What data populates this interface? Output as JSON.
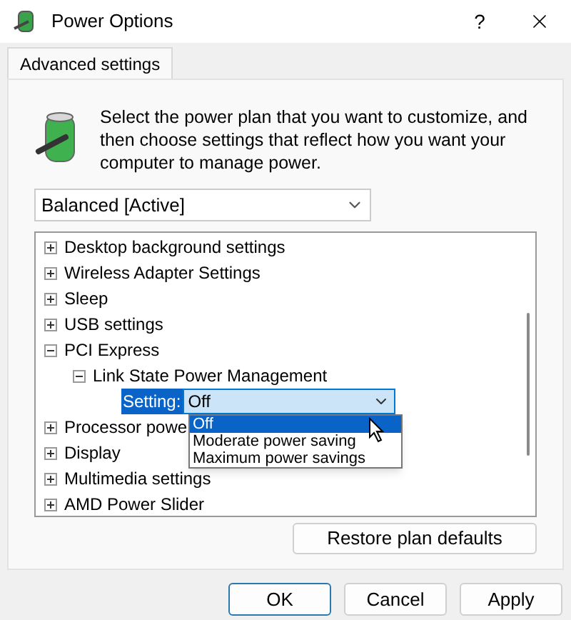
{
  "window": {
    "title": "Power Options",
    "help_button": "?"
  },
  "tabs": [
    {
      "label": "Advanced settings",
      "selected": true
    }
  ],
  "description": "Select the power plan that you want to customize, and then choose settings that reflect how you want your computer to manage power.",
  "plan_select": {
    "value": "Balanced [Active]"
  },
  "tree": [
    {
      "kind": "node",
      "label": "Desktop background settings",
      "expanded": false
    },
    {
      "kind": "node",
      "label": "Wireless Adapter Settings",
      "expanded": false
    },
    {
      "kind": "node",
      "label": "Sleep",
      "expanded": false
    },
    {
      "kind": "node",
      "label": "USB settings",
      "expanded": false
    },
    {
      "kind": "node",
      "label": "PCI Express",
      "expanded": true,
      "children": [
        {
          "kind": "node",
          "label": "Link State Power Management",
          "expanded": true,
          "children": [
            {
              "kind": "setting",
              "label": "Setting:",
              "value": "Off",
              "expanded": true,
              "options": [
                {
                  "label": "Off",
                  "selected": true
                },
                {
                  "label": "Moderate power saving",
                  "selected": false
                },
                {
                  "label": "Maximum power savings",
                  "selected": false
                }
              ]
            }
          ]
        }
      ]
    },
    {
      "kind": "node",
      "label": "Processor powe",
      "expanded": false
    },
    {
      "kind": "node",
      "label": "Display",
      "expanded": false
    },
    {
      "kind": "node",
      "label": "Multimedia settings",
      "expanded": false
    },
    {
      "kind": "node",
      "label": "AMD Power Slider",
      "expanded": false
    }
  ],
  "restore_button": "Restore plan defaults",
  "buttons": [
    {
      "label": "OK",
      "default": true
    },
    {
      "label": "Cancel",
      "default": false
    },
    {
      "label": "Apply",
      "default": false
    }
  ]
}
